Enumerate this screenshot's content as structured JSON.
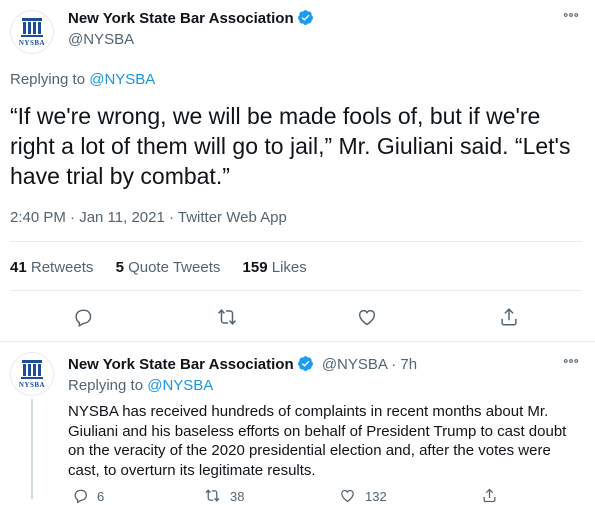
{
  "main_tweet": {
    "author_name": "New York State Bar Association",
    "handle": "@NYSBA",
    "replying_prefix": "Replying to",
    "replying_to": "@NYSBA",
    "text": "“If we're wrong, we will be made fools of, but if we're right a lot of them will go to jail,” Mr. Giuliani said. “Let's have trial by combat.”",
    "timestamp": "2:40 PM · Jan 11, 2021 · Twitter Web App",
    "stats": {
      "retweets_count": "41",
      "retweets_label": "Retweets",
      "quotes_count": "5",
      "quotes_label": "Quote Tweets",
      "likes_count": "159",
      "likes_label": "Likes"
    },
    "more_icon": "more-icon"
  },
  "logo": {
    "text": "NYSBA"
  },
  "reply_tweet": {
    "author_name": "New York State Bar Association",
    "handle_time": "@NYSBA · 7h",
    "replying_prefix": "Replying to",
    "replying_to": "@NYSBA",
    "text": "NYSBA has received hundreds of complaints in recent months about Mr. Giuliani and his baseless efforts on behalf of President Trump to cast doubt on the veracity of the 2020 presidential election and, after the votes were cast, to overturn its legitimate results.",
    "actions": {
      "reply_count": "6",
      "retweet_count": "38",
      "like_count": "132"
    }
  },
  "colors": {
    "accent": "#1b95e0",
    "text": "#0f1419",
    "muted": "#536471",
    "logo_blue": "#1d4e9b"
  }
}
